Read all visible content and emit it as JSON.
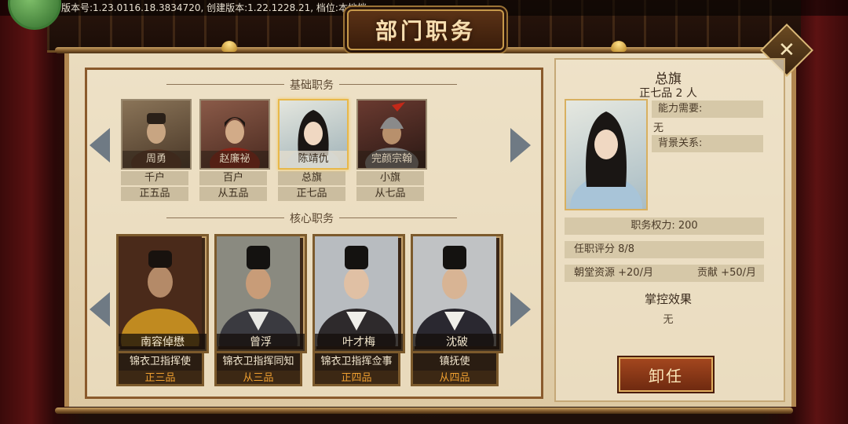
{
  "status_bar": {
    "version_text": "版本号:1.23.0116.18.3834720, 创建版本:1.22.1228.21, 档位:本地档"
  },
  "title": "部门职务",
  "close_label": "✕",
  "sections": {
    "basic": "基础职务",
    "core": "核心职务"
  },
  "basic_positions": [
    {
      "name": "周勇",
      "position": "千户",
      "rank": "正五品",
      "selected": false
    },
    {
      "name": "赵廉祕",
      "position": "百户",
      "rank": "从五品",
      "selected": false
    },
    {
      "name": "陈靖仇",
      "position": "总旗",
      "rank": "正七品",
      "selected": true
    },
    {
      "name": "完颜宗翰",
      "position": "小旗",
      "rank": "从七品",
      "selected": false
    }
  ],
  "core_positions": [
    {
      "name": "南容倬懋",
      "position": "锦衣卫指挥使",
      "rank": "正三品"
    },
    {
      "name": "曾浮",
      "position": "锦衣卫指挥同知",
      "rank": "从三品"
    },
    {
      "name": "叶才梅",
      "position": "锦衣卫指挥佥事",
      "rank": "正四品"
    },
    {
      "name": "沈破",
      "position": "镇抚使",
      "rank": "从四品"
    }
  ],
  "detail": {
    "title": "总旗",
    "subtitle": "正七品 2 人",
    "ability_label": "能力需要:",
    "ability_value": "无",
    "background_label": "背景关系:",
    "power": "职务权力: 200",
    "score": "任职评分   8/8",
    "resource": "朝堂资源 +20/月",
    "contribution": "贡献 +50/月",
    "effect_title": "掌控效果",
    "effect_value": "无",
    "unload_label": "卸任"
  },
  "colors": {
    "accent": "#f0a030",
    "button": "#8a3a18",
    "parchment": "#e6d7b8"
  }
}
